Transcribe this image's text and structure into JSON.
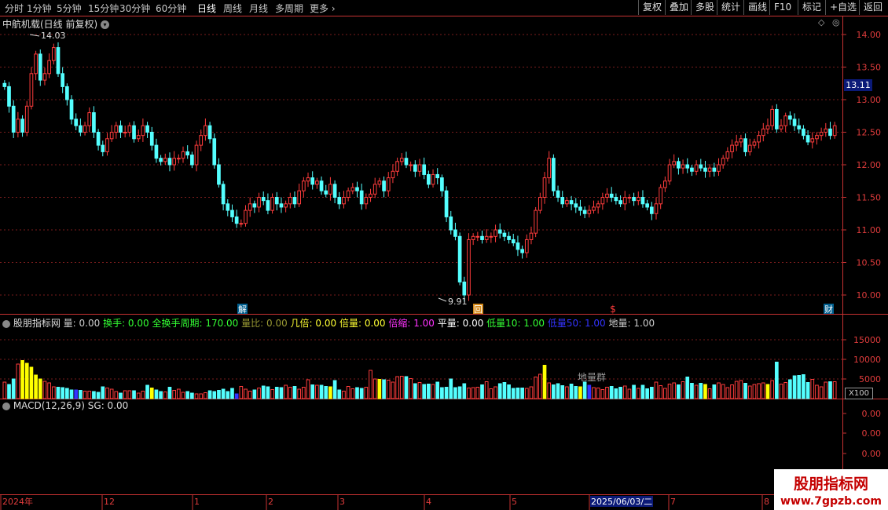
{
  "toolbar": {
    "periods": [
      "分时",
      "1分钟",
      "5分钟",
      "15分钟",
      "30分钟",
      "60分钟",
      "日线",
      "周线",
      "月线",
      "多周期",
      "更多"
    ],
    "active_period": "日线",
    "right_buttons": [
      "复权",
      "叠加",
      "多股",
      "统计",
      "画线",
      "F10",
      "标记",
      "+自选",
      "返回"
    ]
  },
  "main": {
    "title": "中航机载(日线 前复权)",
    "high_label": "14.03",
    "low_label": "9.91",
    "current_price": "13.11",
    "y_ticks": [
      "14.00",
      "13.50",
      "13.00",
      "12.50",
      "12.00",
      "11.50",
      "11.00",
      "10.50",
      "10.00"
    ],
    "markers": {
      "jie": "解",
      "hui": "回",
      "dollar": "$",
      "cai": "财"
    },
    "colors": {
      "up": "#ff3c3c",
      "down": "#54ffff",
      "grid": "#7a1d1d",
      "axis": "#c83232"
    }
  },
  "volume_panel": {
    "prefix": "股朋指标网",
    "indicators": [
      {
        "text": "量: 0.00",
        "color": "#cccccc"
      },
      {
        "text": "换手: 0.00",
        "color": "#33ff33"
      },
      {
        "text": "全换手周期: 170.00",
        "color": "#33ff33"
      },
      {
        "text": "量比: 0.00",
        "color": "#999933"
      },
      {
        "text": "几倍: 0.00",
        "color": "#ffff33"
      },
      {
        "text": "倍量: 0.00",
        "color": "#ffff33"
      },
      {
        "text": "倍缩: 1.00",
        "color": "#ff33ff"
      },
      {
        "text": "平量: 0.00",
        "color": "#ffffff"
      },
      {
        "text": "低量10: 1.00",
        "color": "#33ff33"
      },
      {
        "text": "低量50: 1.00",
        "color": "#3333ff"
      },
      {
        "text": "地量: 1.00",
        "color": "#cccccc"
      }
    ],
    "y_ticks": [
      "15000",
      "10000",
      "5000"
    ],
    "unit": "X100",
    "annotation": "地量群"
  },
  "macd_panel": {
    "title": "MACD(12,26,9) SG: 0.00",
    "y_ticks": [
      "0.00",
      "0.00",
      "0.00"
    ]
  },
  "timeline": {
    "labels": [
      "2024年",
      "12",
      "1",
      "2",
      "3",
      "4",
      "5",
      "2025/06/03/二",
      "7",
      "8"
    ]
  },
  "brand": {
    "name": "股朋指标网",
    "url": "www.7gpzb.com"
  },
  "chart_data": {
    "type": "candlestick",
    "title": "中航机载(日线 前复权)",
    "ylim": [
      9.8,
      14.2
    ],
    "closes": [
      13.2,
      12.9,
      12.5,
      12.7,
      12.5,
      12.9,
      13.4,
      13.7,
      13.3,
      13.4,
      13.6,
      13.8,
      13.4,
      13.2,
      13.0,
      12.7,
      12.6,
      12.5,
      12.6,
      12.8,
      12.5,
      12.3,
      12.2,
      12.4,
      12.5,
      12.6,
      12.5,
      12.5,
      12.6,
      12.4,
      12.45,
      12.6,
      12.5,
      12.3,
      12.1,
      12.05,
      12.1,
      12.0,
      12.1,
      12.1,
      12.2,
      12.15,
      12.0,
      12.3,
      12.45,
      12.6,
      12.4,
      12.0,
      11.7,
      11.4,
      11.3,
      11.2,
      11.1,
      11.1,
      11.3,
      11.4,
      11.35,
      11.5,
      11.45,
      11.3,
      11.5,
      11.4,
      11.35,
      11.4,
      11.5,
      11.4,
      11.6,
      11.75,
      11.8,
      11.7,
      11.75,
      11.6,
      11.55,
      11.7,
      11.5,
      11.4,
      11.5,
      11.6,
      11.65,
      11.6,
      11.4,
      11.5,
      11.55,
      11.7,
      11.75,
      11.6,
      11.8,
      11.9,
      12.05,
      12.1,
      12.0,
      12.0,
      11.9,
      12.0,
      11.85,
      11.7,
      11.85,
      11.8,
      11.6,
      11.2,
      11.0,
      10.9,
      10.2,
      10.0,
      10.85,
      10.9,
      10.9,
      10.85,
      10.9,
      10.9,
      11.0,
      10.95,
      10.9,
      10.85,
      10.8,
      10.7,
      10.65,
      10.85,
      10.95,
      11.3,
      11.5,
      11.8,
      12.1,
      11.6,
      11.5,
      11.4,
      11.45,
      11.4,
      11.35,
      11.3,
      11.25,
      11.3,
      11.35,
      11.4,
      11.5,
      11.55,
      11.5,
      11.45,
      11.4,
      11.5,
      11.5,
      11.45,
      11.5,
      11.4,
      11.35,
      11.25,
      11.4,
      11.65,
      11.75,
      12.0,
      12.05,
      11.95,
      12.0,
      11.95,
      11.9,
      12.0,
      11.95,
      11.9,
      11.95,
      11.9,
      12.0,
      12.1,
      12.2,
      12.3,
      12.35,
      12.4,
      12.2,
      12.3,
      12.35,
      12.45,
      12.55,
      12.6,
      12.85,
      12.55,
      12.6,
      12.75,
      12.7,
      12.6,
      12.55,
      12.45,
      12.35,
      12.4,
      12.45,
      12.5,
      12.55,
      12.45,
      12.6
    ]
  },
  "volume_data": {
    "values": [
      42,
      36,
      50,
      88,
      97,
      90,
      80,
      60,
      50,
      44,
      40,
      30,
      29,
      28,
      26,
      22,
      22,
      21,
      19,
      19,
      18,
      16,
      30,
      27,
      24,
      18,
      14,
      20,
      20,
      20,
      14,
      19,
      34,
      27,
      22,
      18,
      17,
      29,
      21,
      24,
      16,
      18,
      14,
      12,
      12,
      15,
      20,
      18,
      21,
      24,
      18,
      26,
      12,
      31,
      24,
      19,
      22,
      27,
      32,
      30,
      23,
      29,
      28,
      34,
      29,
      31,
      24,
      29,
      48,
      35,
      34,
      34,
      31,
      30,
      46,
      22,
      19,
      31,
      25,
      28,
      26,
      29,
      72,
      50,
      49,
      48,
      47,
      42,
      56,
      57,
      56,
      51,
      38,
      41,
      36,
      37,
      36,
      42,
      28,
      29,
      50,
      28,
      30,
      38,
      27,
      28,
      29,
      35,
      43,
      25,
      30,
      38,
      41,
      35,
      26,
      27,
      27,
      26,
      30,
      55,
      62,
      85,
      40,
      35,
      38,
      33,
      30,
      37,
      31,
      30,
      42,
      34,
      28,
      27,
      23,
      29,
      31,
      25,
      29,
      32,
      24,
      34,
      26,
      34,
      25,
      29,
      42,
      33,
      26,
      37,
      40,
      35,
      43,
      55,
      39,
      34,
      39,
      36,
      25,
      35,
      40,
      36,
      28,
      35,
      44,
      46,
      39,
      32,
      36,
      38,
      40,
      36,
      46,
      93,
      37,
      41,
      48,
      58,
      59,
      61,
      41,
      49,
      34,
      30,
      42,
      43,
      43
    ],
    "colors_hint": {
      "yellow": [
        4,
        5,
        6,
        7,
        8,
        33,
        73,
        84,
        84,
        121,
        129,
        157,
        171
      ],
      "blue": [
        16,
        52,
        131
      ]
    }
  }
}
